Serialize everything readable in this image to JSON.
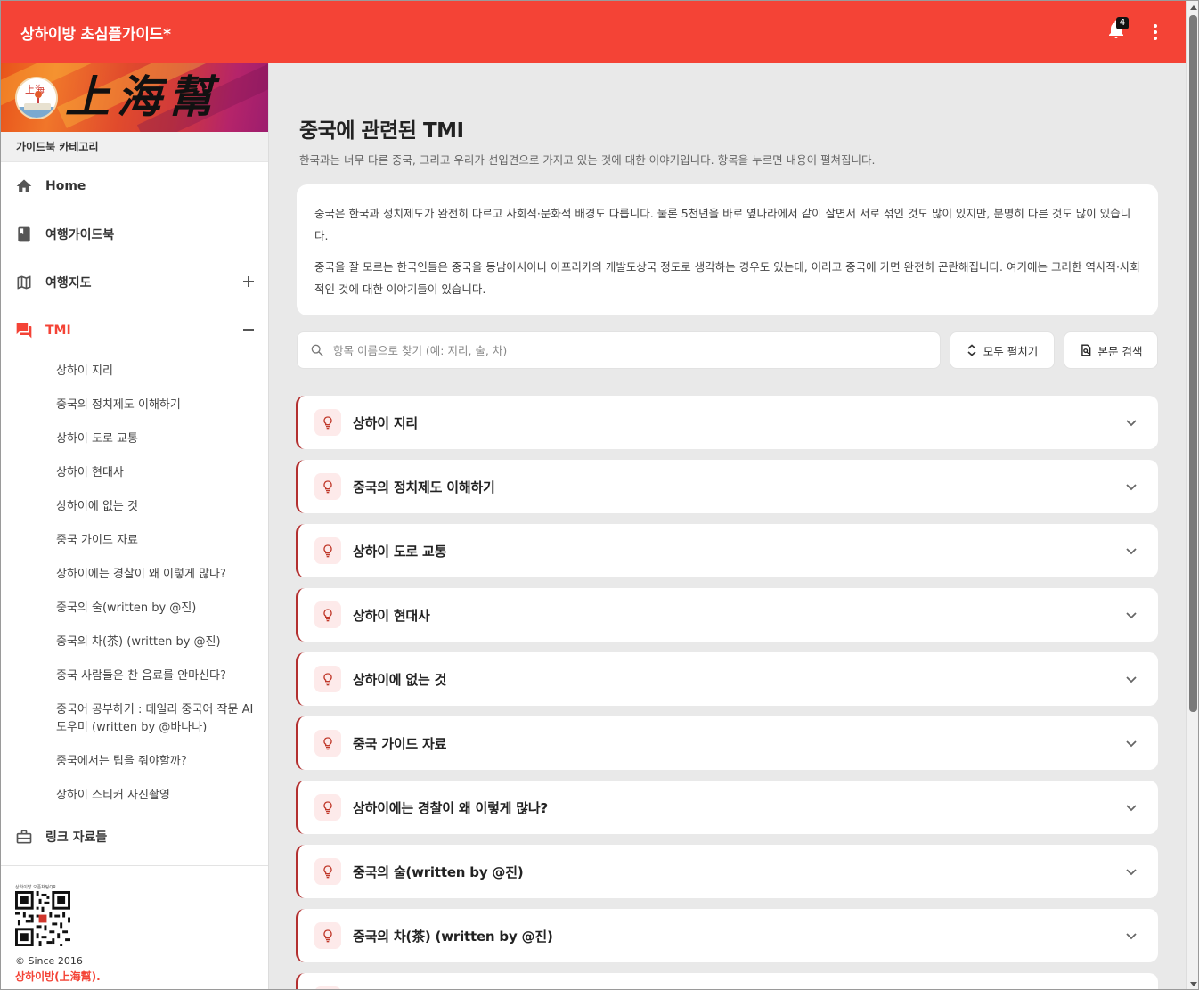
{
  "app": {
    "title": "상하이방 초심플가이드*",
    "notification_count": "4"
  },
  "sidebar": {
    "category_header": "가이드북 카테고리",
    "banner_text": "上海幫",
    "banner_logo_text": "上海",
    "items": [
      {
        "label": "Home",
        "icon": "home-icon"
      },
      {
        "label": "여행가이드북",
        "icon": "book-icon"
      },
      {
        "label": "여행지도",
        "icon": "map-icon",
        "toggle": "expand"
      },
      {
        "label": "TMI",
        "icon": "forum-icon",
        "toggle": "collapse",
        "active": true
      },
      {
        "label": "링크 자료들",
        "icon": "briefcase-icon"
      }
    ],
    "tmi_subitems": [
      "상하이 지리",
      "중국의 정치제도 이해하기",
      "상하이 도로 교통",
      "상하이 현대사",
      "상하이에 없는 것",
      "중국 가이드 자료",
      "상하이에는 경찰이 왜 이렇게 많나?",
      "중국의 술(written by @진)",
      "중국의 차(茶) (written by @진)",
      "중국 사람들은 찬 음료를 안마신다?",
      "중국어 공부하기 : 데일리 중국어 작문 AI도우미 (written by @바나나)",
      "중국에서는 팁을 줘야할까?",
      "상하이 스티커 사진촬영"
    ],
    "footer": {
      "qr_caption": "상하이방 오픈채팅QR",
      "since": "© Since 2016",
      "brand": "상하이방(上海幫)."
    }
  },
  "main": {
    "title": "중국에 관련된 TMI",
    "subtitle": "한국과는 너무 다른 중국, 그리고 우리가 선입견으로 가지고 있는 것에 대한 이야기입니다. 항목을 누르면 내용이 펼쳐집니다.",
    "intro": [
      "중국은 한국과 정치제도가 완전히 다르고 사회적·문화적 배경도 다릅니다. 물론 5천년을 바로 옆나라에서 같이 살면서 서로 섞인 것도 많이 있지만, 분명히 다른 것도 많이 있습니다.",
      "중국을 잘 모르는 한국인들은 중국을 동남아시아나 아프리카의 개발도상국 정도로 생각하는 경우도 있는데, 이러고 중국에 가면 완전히 곤란해집니다. 여기에는 그러한 역사적·사회적인 것에 대한 이야기들이 있습니다."
    ],
    "search": {
      "placeholder": "항목 이름으로 찾기 (예: 지리, 술, 차)",
      "value": ""
    },
    "expand_all_label": "모두 펼치기",
    "fulltext_search_label": "본문 검색",
    "accordion": [
      "상하이 지리",
      "중국의 정치제도 이해하기",
      "상하이 도로 교통",
      "상하이 현대사",
      "상하이에 없는 것",
      "중국 가이드 자료",
      "상하이에는 경찰이 왜 이렇게 많나?",
      "중국의 술(written by @진)",
      "중국의 차(茶) (written by @진)",
      ""
    ]
  },
  "colors": {
    "primary": "#f44336",
    "accent_border": "#b33030",
    "icon_bg": "#fdeaea"
  }
}
